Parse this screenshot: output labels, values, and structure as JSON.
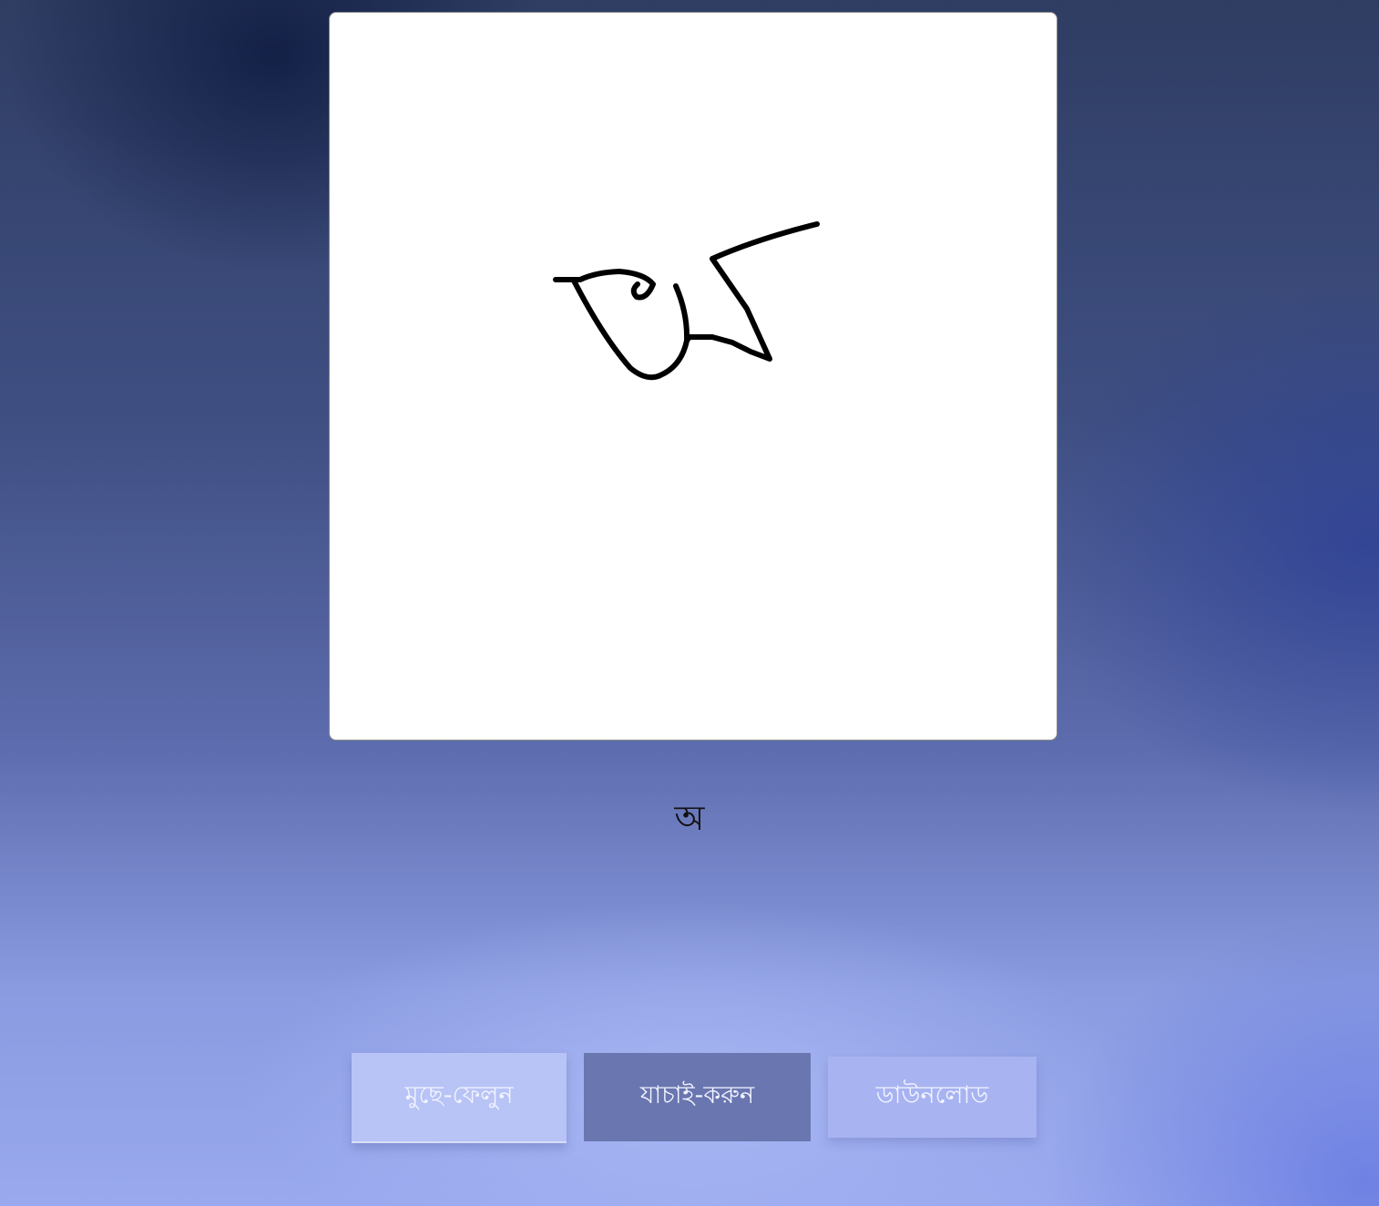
{
  "drawing_canvas": {
    "background": "#ffffff",
    "stroke_color": "#000000"
  },
  "prediction": {
    "text": "অ"
  },
  "buttons": {
    "clear_label": "মুছে-ফেলুন",
    "check_label": "যাচাই-করুন",
    "download_label": "ডাউনলোড"
  },
  "colors": {
    "clear_button": "#b8c3f6",
    "check_button": "#6a76b0",
    "download_button": "#a8b3f1",
    "button_text": "#f2f4ff"
  }
}
